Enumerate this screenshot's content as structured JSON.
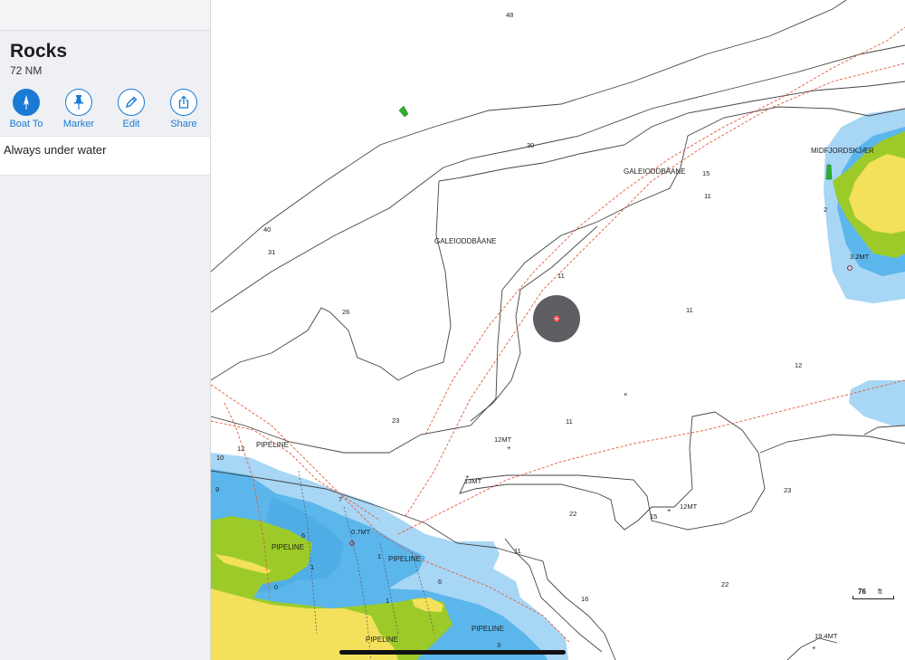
{
  "sidebar": {
    "title": "Rocks",
    "distance": "72 NM",
    "actions": [
      {
        "label": "Boat To",
        "icon": "compass-icon"
      },
      {
        "label": "Marker",
        "icon": "pin-icon"
      },
      {
        "label": "Edit",
        "icon": "pencil-icon"
      },
      {
        "label": "Share",
        "icon": "share-icon"
      }
    ],
    "description": "Always under water"
  },
  "map": {
    "colors": {
      "land": "#f3e05b",
      "intertidal": "#9ccb29",
      "shallow": "#5bb6ec",
      "medium": "#a8d6f5",
      "route": "#e35c3c"
    },
    "place_names": [
      "GALEIODDBÅANE",
      "GALEIODDBÅANE",
      "MIDFJORDSKJÆR"
    ],
    "pipeline_labels": [
      "PIPELINE",
      "PIPELINE",
      "PIPELINE",
      "PIPELINE",
      "PIPELINE"
    ],
    "soundings": [
      "48",
      "30",
      "15",
      "11",
      "40",
      "31",
      "26",
      "11",
      "11",
      "12",
      "23",
      "11",
      "12",
      "10",
      "9",
      "7",
      "6",
      "1",
      "1",
      "6",
      "1",
      "0",
      "11",
      "16",
      "22",
      "15",
      "23",
      "22",
      "2",
      "3",
      "19.4MT"
    ],
    "marks": [
      "3.2MT",
      "12MT",
      "13MT",
      "12MT",
      "0.7MT"
    ]
  },
  "scale": {
    "value": "76",
    "unit": "ft"
  }
}
